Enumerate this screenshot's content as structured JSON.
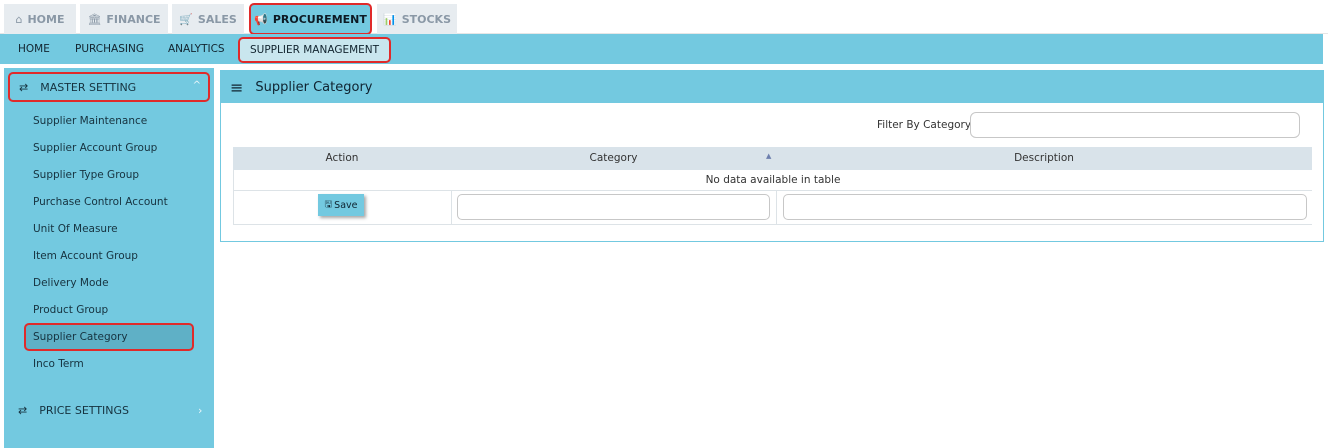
{
  "top_tabs": [
    {
      "icon": "⌂",
      "icon_name": "home-icon",
      "label": "HOME"
    },
    {
      "icon": "🏛",
      "icon_name": "bank-icon",
      "label": "FINANCE"
    },
    {
      "icon": "🛒",
      "icon_name": "cart-icon",
      "label": "SALES"
    },
    {
      "icon": "📢",
      "icon_name": "megaphone-icon",
      "label": "PROCUREMENT"
    },
    {
      "icon": "📊",
      "icon_name": "bar-chart-icon",
      "label": "STOCKS"
    }
  ],
  "sub_nav": [
    "HOME",
    "PURCHASING",
    "ANALYTICS",
    "SUPPLIER MANAGEMENT"
  ],
  "sidebar": {
    "section1": {
      "icon": "⇄",
      "title": "MASTER SETTING",
      "chevron": "^"
    },
    "items": [
      "Supplier Maintenance",
      "Supplier Account Group",
      "Supplier Type Group",
      "Purchase Control Account",
      "Unit Of Measure",
      "Item Account Group",
      "Delivery Mode",
      "Product Group",
      "Supplier Category",
      "Inco Term"
    ],
    "section2": {
      "icon": "⇄",
      "title": "PRICE SETTINGS",
      "chevron": "›"
    }
  },
  "panel": {
    "menu_icon": "≡",
    "title": "Supplier Category",
    "filter_label": "Filter By Category",
    "filter_value": "",
    "table": {
      "headers": [
        "Action",
        "Category",
        "Description"
      ],
      "sort_indicator": "▲",
      "empty_message": "No data available in table",
      "save_icon": "🖫",
      "save_label": "Save"
    }
  },
  "colors": {
    "accent": "#73c9e0",
    "highlight": "#e02a2a",
    "table_header": "#d9e3ea"
  }
}
